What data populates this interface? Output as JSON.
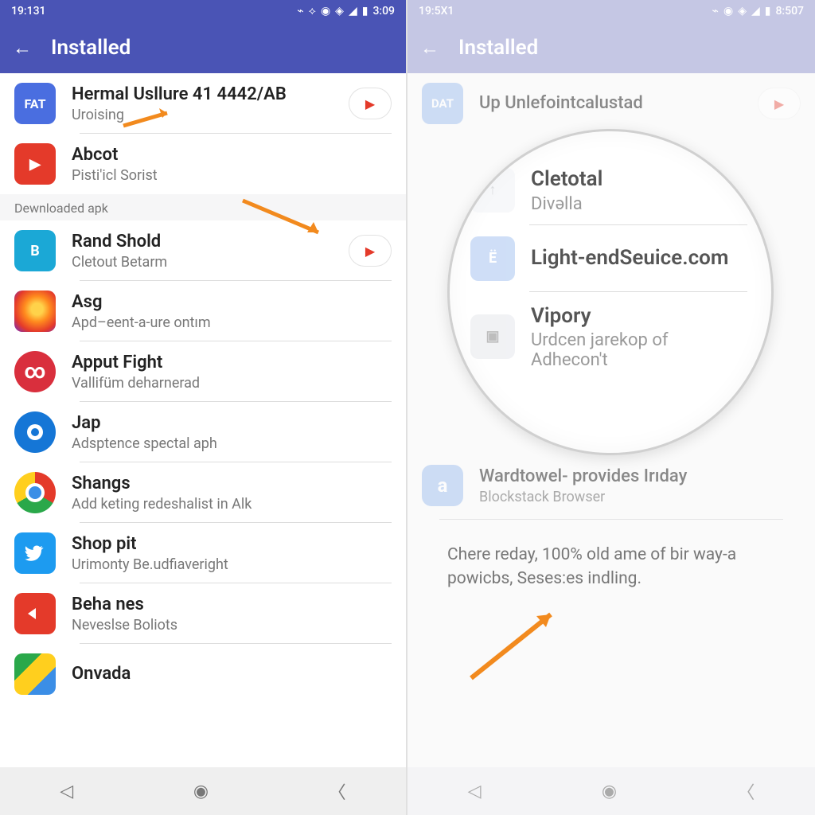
{
  "left": {
    "status_time": "19:131",
    "status_right": "3:09",
    "appbar_title": "Installed",
    "section_label": "Dewnloaded apk",
    "rows": [
      {
        "title": "Hermal Usllure 41 4442/AB",
        "sub": "Uroising",
        "has_play": true
      },
      {
        "title": "Abcot",
        "sub": "Pisti'icl Sorist",
        "has_play": false
      },
      {
        "title": "Rand Shold",
        "sub": "Cletout Betarm",
        "has_play": true
      },
      {
        "title": "Asg",
        "sub": "Apd–eent-a-ure ontım",
        "has_play": false
      },
      {
        "title": "Apput Fight",
        "sub": "Vallifüm deharnerad",
        "has_play": false
      },
      {
        "title": "Jap",
        "sub": "Adsptence spectal aph",
        "has_play": false
      },
      {
        "title": "Shangs",
        "sub": "Add keting redeshalist in Alk",
        "has_play": false
      },
      {
        "title": "Shop pit",
        "sub": "Urimonty Be.udfiaveright",
        "has_play": false
      },
      {
        "title": "Beha nes",
        "sub": "Neveslse Boliots",
        "has_play": false
      },
      {
        "title": "Onvada",
        "sub": "",
        "has_play": false
      }
    ],
    "icons_text": {
      "fat": "FAT",
      "b": "B",
      "cp": "∞"
    }
  },
  "right": {
    "status_time": "19:5X1",
    "status_right": "8:507",
    "appbar_title": "Installed",
    "top_row": {
      "title": "Up Unlefointcalustad",
      "sub": ""
    },
    "lens_rows": [
      {
        "title": "Cletotal",
        "sub": "Divəlla"
      },
      {
        "title": "Light-endSeuice.com",
        "sub": ""
      },
      {
        "title": "Vipory",
        "sub": "Urdcen jarekop of Adhecon't"
      }
    ],
    "bottom_row": {
      "title": "Wardtowel- provides Irıday",
      "sub": "Blockstack Browser"
    },
    "desc": "Chere reday, 100% old ame of bir way-a powicbs, Seses:es indling.",
    "icons_text": {
      "dat": "DAT",
      "up": "↑",
      "e": "Ë",
      "a": "a"
    }
  }
}
